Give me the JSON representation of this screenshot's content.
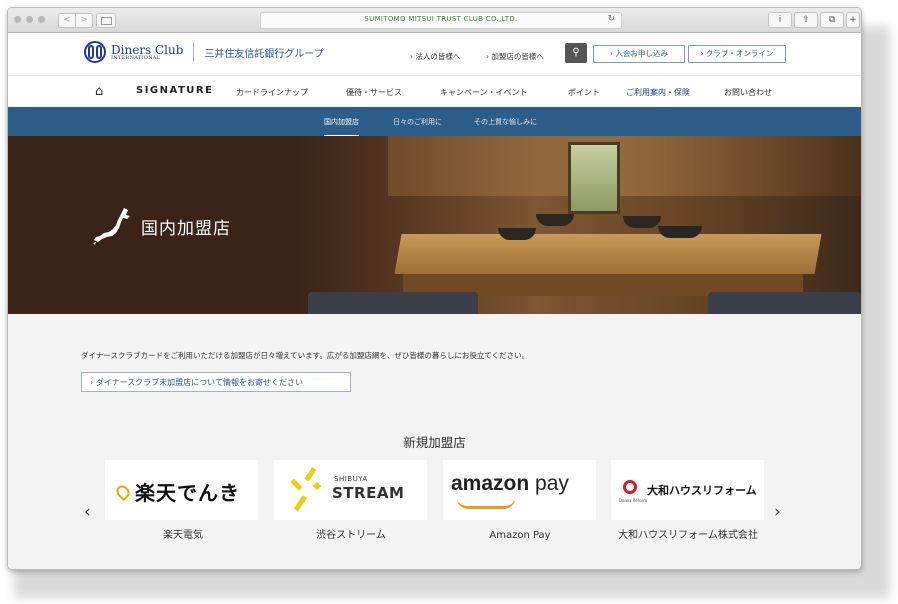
{
  "browser": {
    "url": "SUMITOMO MITSUI TRUST CLUB CO.,LTD.",
    "back": "<",
    "forward": ">",
    "reload": "↻",
    "buttons": [
      "i",
      "⇪",
      "⧉",
      "+"
    ]
  },
  "header": {
    "logo_main": "Diners Club",
    "logo_sub": "INTERNATIONAL",
    "group_name": "三井住友信託銀行グループ",
    "links": [
      "› 法人の皆様へ",
      "› 加盟店の皆様へ"
    ],
    "search_icon": "search-icon",
    "search_glyph": "⚲",
    "join_button": "› 入会お申し込み",
    "club_online_button": "› クラブ・オンライン"
  },
  "main_nav": {
    "home_icon": "⌂",
    "signature": "SIGNATURE",
    "items": [
      "カードラインナップ",
      "優待・サービス",
      "キャンペーン・イベント",
      "ポイント",
      "ご利用案内・保険",
      "お問い合わせ"
    ],
    "active_item": "ご利用案内・保険"
  },
  "sub_nav": {
    "items": [
      "国内加盟店",
      "日々のご利用に",
      "その上質な愉しみに"
    ],
    "active_item": "国内加盟店"
  },
  "hero": {
    "title": "国内加盟店",
    "icon": "japan-map-icon"
  },
  "content": {
    "intro": "ダイナースクラブカードをご利用いただける加盟店が日々増えています。広がる加盟店網を、ぜひ皆様の暮らしにお役立てください。",
    "info_button": "› ダイナースクラブ未加盟店について情報をお寄せください",
    "section_title": "新規加盟店",
    "prev_arrow": "‹",
    "next_arrow": "›",
    "merchants": [
      {
        "name": "楽天電気",
        "logo_text": "楽天でんき"
      },
      {
        "name": "渋谷ストリーム",
        "logo_sub": "SHIBUYA",
        "logo_text": "STREAM"
      },
      {
        "name": "Amazon Pay",
        "logo_text_bold": "amazon",
        "logo_text": " pay"
      },
      {
        "name": "大和ハウスリフォーム株式会社",
        "logo_text": "大和ハウスリフォーム",
        "logo_sub": "Daiwa Reform"
      }
    ]
  },
  "colors": {
    "brand_blue": "#1c3b8f",
    "subnav_blue": "#2d5e8a",
    "amazon_orange": "#f29a1a",
    "stream_yellow": "#e8d200",
    "daiwa_red": "#d01f1f"
  }
}
